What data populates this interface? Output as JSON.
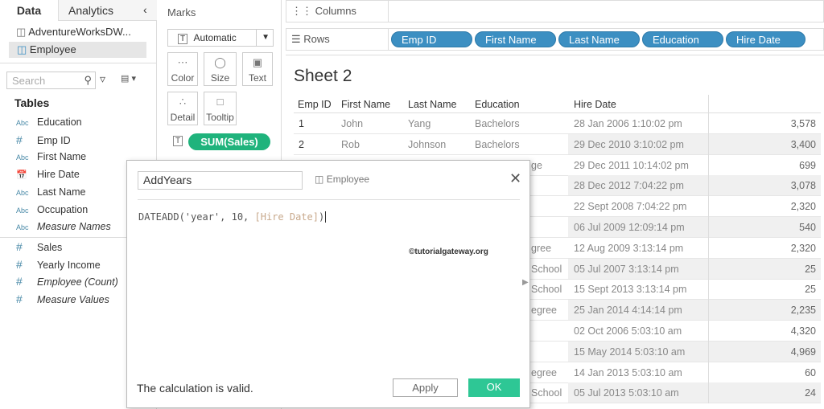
{
  "left": {
    "tabs": [
      "Data",
      "Analytics"
    ],
    "collapse_icon": "chevron-left-icon",
    "sources": [
      "AdventureWorksDW...",
      "Employee"
    ],
    "search_placeholder": "Search",
    "tables_heading": "Tables",
    "dimensions": [
      {
        "type": "Abc",
        "name": "Education"
      },
      {
        "type": "#",
        "name": "Emp ID"
      },
      {
        "type": "Abc",
        "name": "First Name"
      },
      {
        "type": "date",
        "name": "Hire Date"
      },
      {
        "type": "Abc",
        "name": "Last Name"
      },
      {
        "type": "Abc",
        "name": "Occupation"
      },
      {
        "type": "Abc",
        "name": "Measure Names",
        "italic": true
      }
    ],
    "measures": [
      {
        "type": "#",
        "name": "Sales"
      },
      {
        "type": "#",
        "name": "Yearly Income"
      },
      {
        "type": "#",
        "name": "Employee (Count)",
        "italic": true
      },
      {
        "type": "#",
        "name": "Measure Values",
        "italic": true
      }
    ]
  },
  "marks": {
    "title": "Marks",
    "type": "Automatic",
    "cards": [
      "Color",
      "Size",
      "Text",
      "Detail",
      "Tooltip"
    ],
    "pill": "SUM(Sales)"
  },
  "shelves": {
    "columns_label": "Columns",
    "rows_label": "Rows",
    "rows_pills": [
      "Emp ID",
      "First Name",
      "Last Name",
      "Education",
      "Hire Date"
    ]
  },
  "sheet": {
    "title": "Sheet 2",
    "headers": [
      "Emp ID",
      "First Name",
      "Last Name",
      "Education",
      "Hire Date"
    ],
    "rows": [
      {
        "id": "1",
        "first": "John",
        "last": "Yang",
        "edu": "Bachelors",
        "hire": "28 Jan 2006 1:10:02 pm",
        "sales": "3,578"
      },
      {
        "id": "2",
        "first": "Rob",
        "last": "Johnson",
        "edu": "Bachelors",
        "hire": "29 Dec 2010 3:10:02 pm",
        "sales": "3,400"
      },
      {
        "edu_partial": "ge",
        "hire": "29 Dec 2011 10:14:02 pm",
        "sales": "699"
      },
      {
        "edu_partial": "",
        "hire": "28 Dec 2012 7:04:22 pm",
        "sales": "3,078"
      },
      {
        "edu_partial": "",
        "hire": "22 Sept 2008 7:04:22 pm",
        "sales": "2,320"
      },
      {
        "edu_partial": "",
        "hire": "06 Jul 2009 12:09:14 pm",
        "sales": "540"
      },
      {
        "edu_partial": "gree",
        "hire": "12 Aug 2009 3:13:14 pm",
        "sales": "2,320"
      },
      {
        "edu_partial": "School",
        "hire": "05 Jul 2007 3:13:14 pm",
        "sales": "25"
      },
      {
        "edu_partial": "School",
        "hire": "15 Sept 2013 3:13:14 pm",
        "sales": "25"
      },
      {
        "edu_partial": "egree",
        "hire": "25 Jan 2014 4:14:14 pm",
        "sales": "2,235"
      },
      {
        "edu_partial": "",
        "hire": "02 Oct 2006 5:03:10 am",
        "sales": "4,320"
      },
      {
        "edu_partial": "",
        "hire": "15 May 2014 5:03:10 am",
        "sales": "4,969"
      },
      {
        "edu_partial": "egree",
        "hire": "14 Jan 2013 5:03:10 am",
        "sales": "60"
      },
      {
        "edu_partial": "School",
        "hire": "05 Jul 2013 5:03:10 am",
        "sales": "24"
      }
    ]
  },
  "dialog": {
    "name": "AddYears",
    "datasource": "Employee",
    "formula_fn": "DATEADD(",
    "formula_args": "'year', 10, ",
    "formula_field": "[Hire Date]",
    "formula_end": ")",
    "watermark": "©tutorialgateway.org",
    "status": "The calculation is valid.",
    "apply": "Apply",
    "ok": "OK"
  },
  "colors": {
    "pill_blue": "#3c8fc2",
    "pill_green": "#1fb37c",
    "ok": "#2ec795"
  }
}
